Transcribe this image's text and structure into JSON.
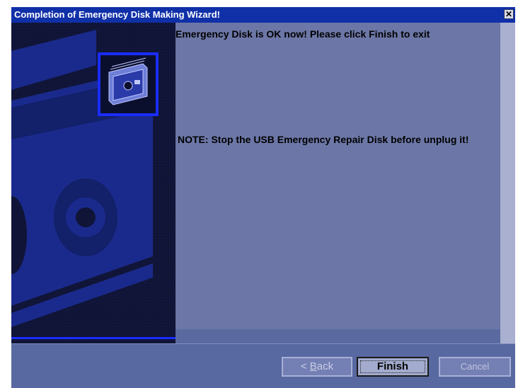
{
  "window": {
    "title": "Completion of Emergency Disk Making Wizard!",
    "close_glyph": "✕"
  },
  "content": {
    "message": "Emergency Disk is OK now! Please click Finish to exit",
    "note": "NOTE: Stop the USB Emergency Repair Disk before unplug it!"
  },
  "buttons": {
    "back_prefix": "< ",
    "back_underlined": "B",
    "back_rest": "ack",
    "finish_label": "Finish",
    "cancel_label": "Cancel"
  },
  "icons": {
    "wizard_icon": "usb-drive-icon",
    "close_icon": "close-icon"
  },
  "colors": {
    "titlebar": "#1030a8",
    "content_bg": "#6c77a7",
    "left_panel_bg": "#101436",
    "accent_blue": "#1a2cff"
  }
}
